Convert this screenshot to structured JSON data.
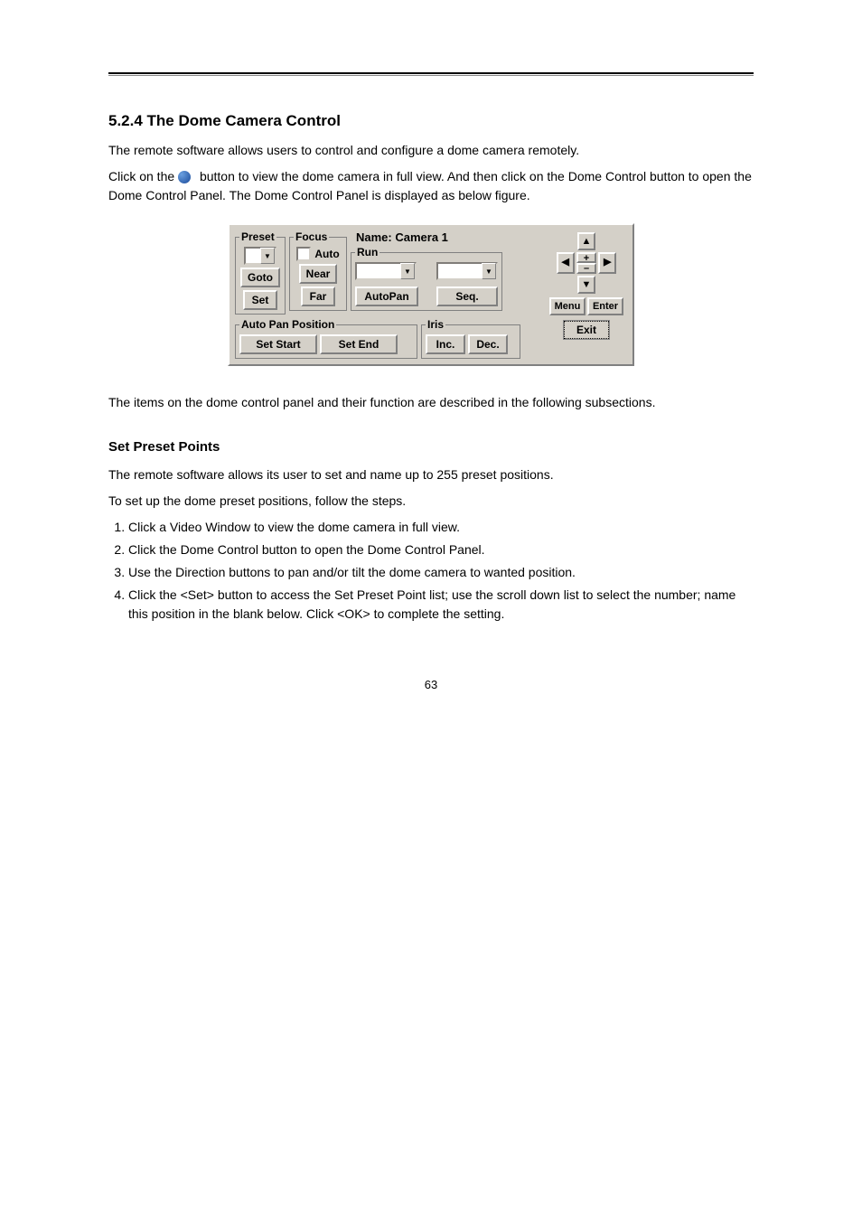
{
  "page_number": "63",
  "section1": {
    "heading": "5.2.4 The Dome Camera Control",
    "p1": "The remote software allows users to control and configure a dome camera remotely.",
    "p2_prefix": "Click on the ",
    "p2_iconname": "globe-icon",
    "p2_suffix": " button to view the dome camera in full view. And then click on the Dome Control button to open the Dome Control Panel. The Dome Control Panel is displayed as below figure.",
    "p3": "The items on the dome control panel and their function are described in the following subsections."
  },
  "panel": {
    "preset": {
      "legend": "Preset",
      "goto": "Goto",
      "set": "Set"
    },
    "focus": {
      "legend": "Focus",
      "auto_label": "Auto",
      "near": "Near",
      "far": "Far"
    },
    "name_label": "Name: Camera 1",
    "run": {
      "legend": "Run",
      "autopan": "AutoPan",
      "seq": "Seq."
    },
    "autopanpos": {
      "legend": "Auto Pan Position",
      "setstart": "Set Start",
      "setend": "Set End"
    },
    "iris": {
      "legend": "Iris",
      "inc": "Inc.",
      "dec": "Dec."
    },
    "nav": {
      "up": "▲",
      "down": "▼",
      "left": "◀",
      "right": "▶",
      "plus": "+",
      "minus": "–",
      "menu": "Menu",
      "enter": "Enter",
      "exit": "Exit"
    }
  },
  "section2": {
    "heading": "Set Preset Points",
    "p1": "The remote software allows its user to set and name up to 255 preset positions.",
    "p2": "To set up the dome preset positions, follow the steps.",
    "steps": [
      "Click a Video Window to view the dome camera in full view.",
      "Click the Dome Control button to open the Dome Control Panel.",
      "Use the Direction buttons to pan and/or tilt the dome camera to wanted position.",
      "Click the <Set> button to access the Set Preset Point list; use the scroll down list to select the number; name this position in the blank below. Click <OK> to complete the setting."
    ]
  }
}
